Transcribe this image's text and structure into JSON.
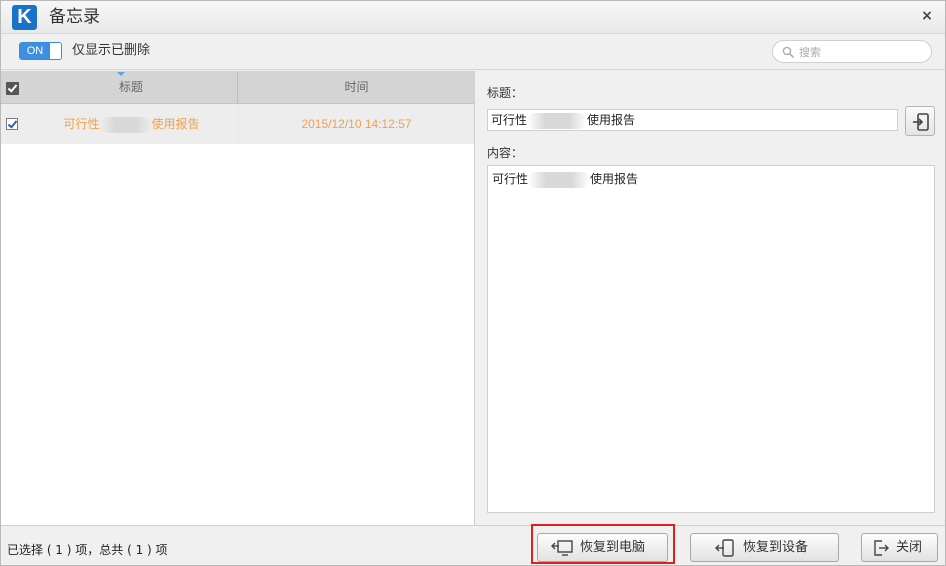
{
  "window": {
    "title": "备忘录",
    "logo_letter": "K",
    "close_glyph": "×"
  },
  "toolbar": {
    "toggle_state": "ON",
    "toggle_label": "仅显示已删除",
    "search_placeholder": "搜索"
  },
  "list": {
    "columns": [
      "标题",
      "时间"
    ],
    "rows": [
      {
        "title_prefix": "可行性",
        "title_suffix": "使用报告",
        "time": "2015/12/10 14:12:57",
        "checked": true
      }
    ]
  },
  "detail": {
    "title_label": "标题：",
    "title_prefix": "可行性",
    "title_suffix": "使用报告",
    "content_label": "内容：",
    "content_prefix": "可行性",
    "content_suffix": "使用报告"
  },
  "status": {
    "summary": "已选择 ( 1 ) 项，总共 ( 1 ) 项",
    "restore_pc_label": "恢复到电脑",
    "restore_device_label": "恢复到设备",
    "close_label": "关闭"
  },
  "colors": {
    "accent": "#3d8fe0",
    "row_text": "#f0a050",
    "highlight": "#e02020",
    "logo_bg": "#1a73c9"
  },
  "icons": {
    "logo": "app-logo-icon",
    "search": "search-icon",
    "export": "export-to-device-icon",
    "restore_pc": "restore-computer-icon",
    "restore_device": "restore-device-icon",
    "close": "exit-icon"
  }
}
